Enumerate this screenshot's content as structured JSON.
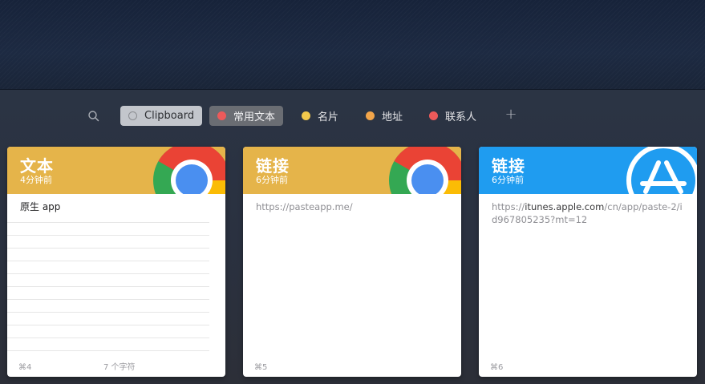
{
  "toolbar": {
    "search_icon": "search-icon",
    "chips": [
      {
        "label": "Clipboard",
        "color": "#8b8d92",
        "state": "selected"
      },
      {
        "label": "常用文本",
        "color": "#ec5a5a",
        "state": "active"
      },
      {
        "label": "名片",
        "color": "#f2c94c",
        "state": "normal"
      },
      {
        "label": "地址",
        "color": "#f2a54a",
        "state": "normal"
      },
      {
        "label": "联系人",
        "color": "#ec5a5a",
        "state": "normal"
      }
    ],
    "add_label": "+"
  },
  "cards": [
    {
      "type": "文本",
      "time": "4分钟前",
      "header_color": "#e5b44a",
      "app_icon": "chrome-icon",
      "content": "原生 app",
      "shortcut": "⌘4",
      "count": "7 个字符"
    },
    {
      "type": "链接",
      "time": "6分钟前",
      "header_color": "#e5b44a",
      "app_icon": "chrome-icon",
      "content": "https://pasteapp.me/",
      "shortcut": "⌘5"
    },
    {
      "type": "链接",
      "time": "6分钟前",
      "header_color": "#1f9cf0",
      "app_icon": "app-store-icon",
      "content_prefix": "https://",
      "content_highlight": "itunes.apple.com",
      "content_suffix": "/cn/app/paste-2/id967805235?mt=12",
      "shortcut": "⌘6"
    }
  ]
}
